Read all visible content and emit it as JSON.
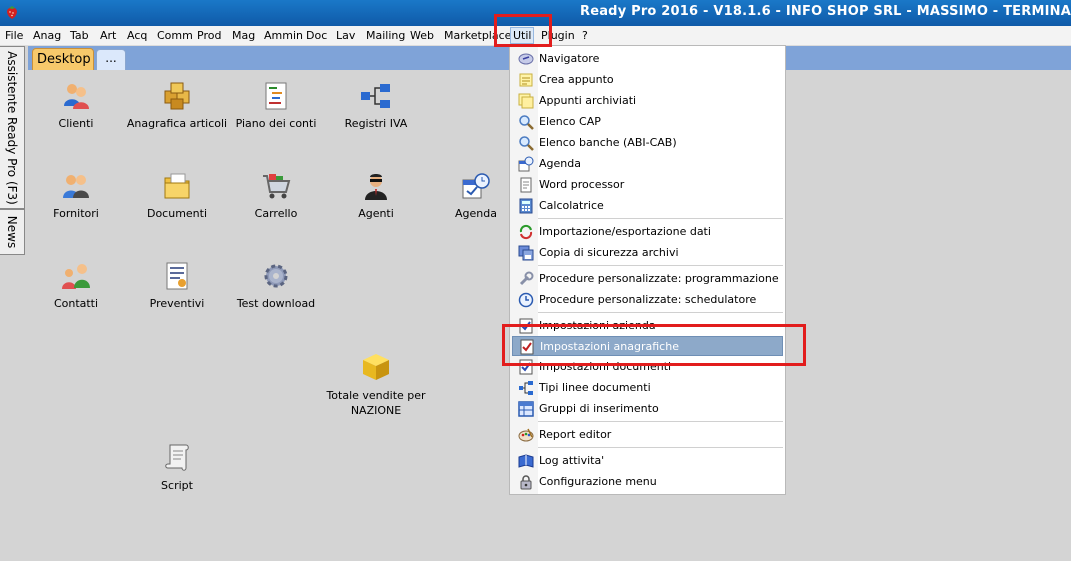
{
  "window": {
    "title": "Ready Pro 2016 - V18.1.6 - INFO SHOP SRL - MASSIMO - TERMINA"
  },
  "menubar": [
    {
      "label": "File"
    },
    {
      "label": "Anag"
    },
    {
      "label": "Tab"
    },
    {
      "label": "Art"
    },
    {
      "label": "Acq"
    },
    {
      "label": "Comm"
    },
    {
      "label": "Prod"
    },
    {
      "label": "Mag"
    },
    {
      "label": "Ammin"
    },
    {
      "label": "Doc"
    },
    {
      "label": "Lav"
    },
    {
      "label": "Mailing"
    },
    {
      "label": "Web"
    },
    {
      "label": "Marketplace"
    },
    {
      "label": "Util"
    },
    {
      "label": "Plugin"
    },
    {
      "label": "?"
    }
  ],
  "side_tabs": {
    "assistant": "Assistente Ready Pro (F3)",
    "news": "News"
  },
  "tabs": {
    "desktop": "Desktop",
    "more": "..."
  },
  "desktop_icons": [
    {
      "label": "Clienti",
      "icon": "customers-icon"
    },
    {
      "label": "Anagrafica articoli",
      "icon": "boxes-icon"
    },
    {
      "label": "Piano dei conti",
      "icon": "chart-of-accounts-icon"
    },
    {
      "label": "Registri IVA",
      "icon": "tree-diagram-icon"
    },
    {
      "label": "Fornitori",
      "icon": "suppliers-icon"
    },
    {
      "label": "Documenti",
      "icon": "folder-icon"
    },
    {
      "label": "Carrello",
      "icon": "shopping-cart-icon"
    },
    {
      "label": "Agenti",
      "icon": "agent-icon"
    },
    {
      "label": "Agenda",
      "icon": "calendar-clock-icon"
    },
    {
      "label": "Contatti",
      "icon": "contacts-icon"
    },
    {
      "label": "Preventivi",
      "icon": "quote-document-icon"
    },
    {
      "label": "Test download",
      "icon": "gear-icon"
    },
    {
      "label": "Totale vendite per NAZIONE",
      "icon": "gold-cube-icon"
    },
    {
      "label": "Script",
      "icon": "scroll-icon"
    }
  ],
  "util_menu": {
    "items": [
      {
        "label": "Navigatore",
        "icon": "navigator-icon"
      },
      {
        "label": "Crea appunto",
        "icon": "note-icon"
      },
      {
        "label": "Appunti archiviati",
        "icon": "notes-archive-icon"
      },
      {
        "label": "Elenco CAP",
        "icon": "magnifier-icon"
      },
      {
        "label": "Elenco banche (ABI-CAB)",
        "icon": "magnifier-icon"
      },
      {
        "label": "Agenda",
        "icon": "calendar-clock-icon"
      },
      {
        "label": "Word processor",
        "icon": "document-icon"
      },
      {
        "label": "Calcolatrice",
        "icon": "calculator-icon"
      },
      {
        "label": "Importazione/esportazione dati",
        "icon": "import-export-icon"
      },
      {
        "label": "Copia di sicurezza archivi",
        "icon": "backup-icon"
      },
      {
        "label": "Procedure personalizzate: programmazione",
        "icon": "wrench-icon"
      },
      {
        "label": "Procedure personalizzate: schedulatore",
        "icon": "clock-icon"
      },
      {
        "label": "Impostazioni azienda",
        "icon": "checklist-icon"
      },
      {
        "label": "Impostazioni anagrafiche",
        "icon": "checklist-icon"
      },
      {
        "label": "Impostazioni documenti",
        "icon": "checklist-icon"
      },
      {
        "label": "Tipi linee documenti",
        "icon": "tree-diagram-icon"
      },
      {
        "label": "Gruppi di inserimento",
        "icon": "grid-icon"
      },
      {
        "label": "Report editor",
        "icon": "palette-icon"
      },
      {
        "label": "Log attivita'",
        "icon": "log-book-icon"
      },
      {
        "label": "Configurazione menu",
        "icon": "lock-config-icon"
      }
    ],
    "highlighted": "Impostazioni anagrafiche"
  },
  "colors": {
    "titlebar": "#1a78c8",
    "tabstrip": "#7fa3d8",
    "desktop_tab": "#f7c96b",
    "highlight": "#8da9c9",
    "annotation": "#e21d1d"
  }
}
